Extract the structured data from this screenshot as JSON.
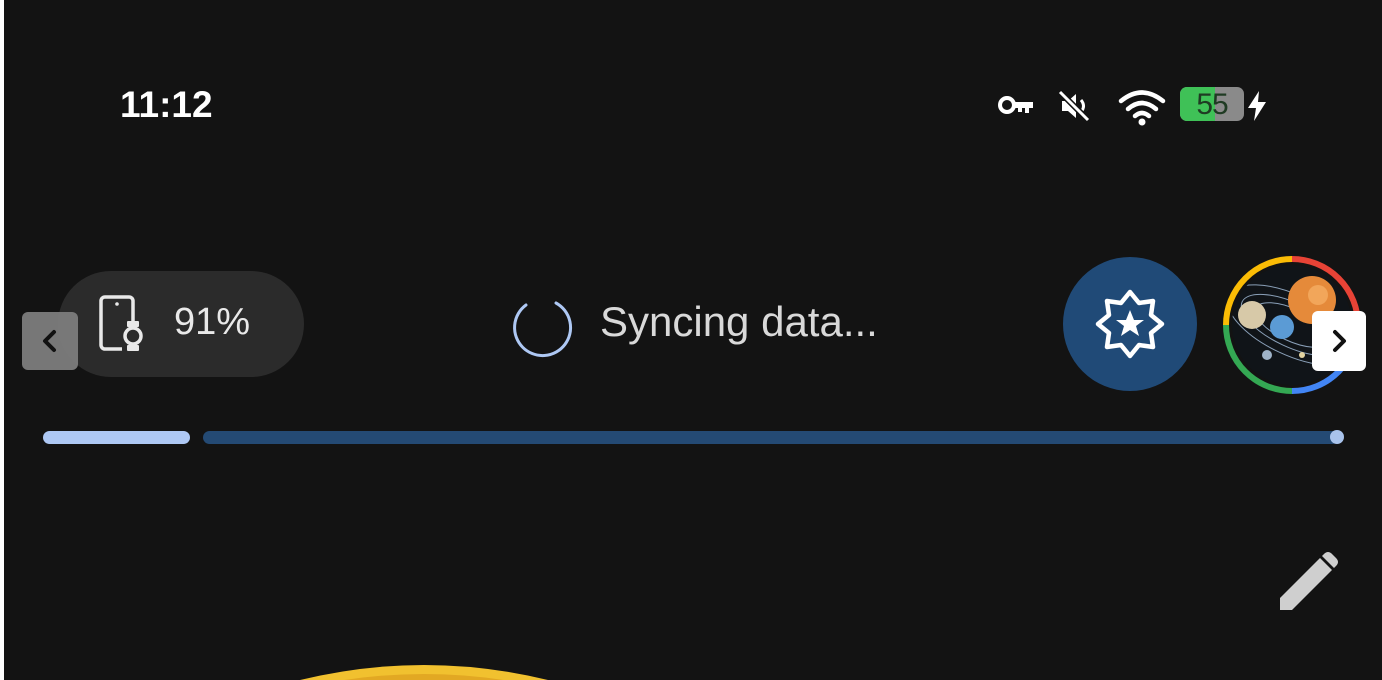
{
  "status_bar": {
    "time": "11:12",
    "battery_level": "55",
    "battery_fraction": 0.55,
    "icons": [
      "key-icon",
      "muted-icon",
      "wifi-icon",
      "charging-icon"
    ]
  },
  "watch_status": {
    "battery": "91%",
    "icon": "phone-watch-icon"
  },
  "sync": {
    "label": "Syncing data..."
  },
  "badge": {
    "icon": "star-badge-icon"
  },
  "profile": {
    "icon": "avatar-solar-system"
  },
  "progress": {
    "segments": 2,
    "active_segment": 1
  },
  "actions": {
    "edit": "pencil-icon",
    "prev": "chevron-left-icon",
    "next": "chevron-right-icon"
  },
  "colors": {
    "background": "#131313",
    "accent_blue": "#204a77",
    "progress_active": "#aec8f4",
    "battery_green": "#3fc157"
  }
}
